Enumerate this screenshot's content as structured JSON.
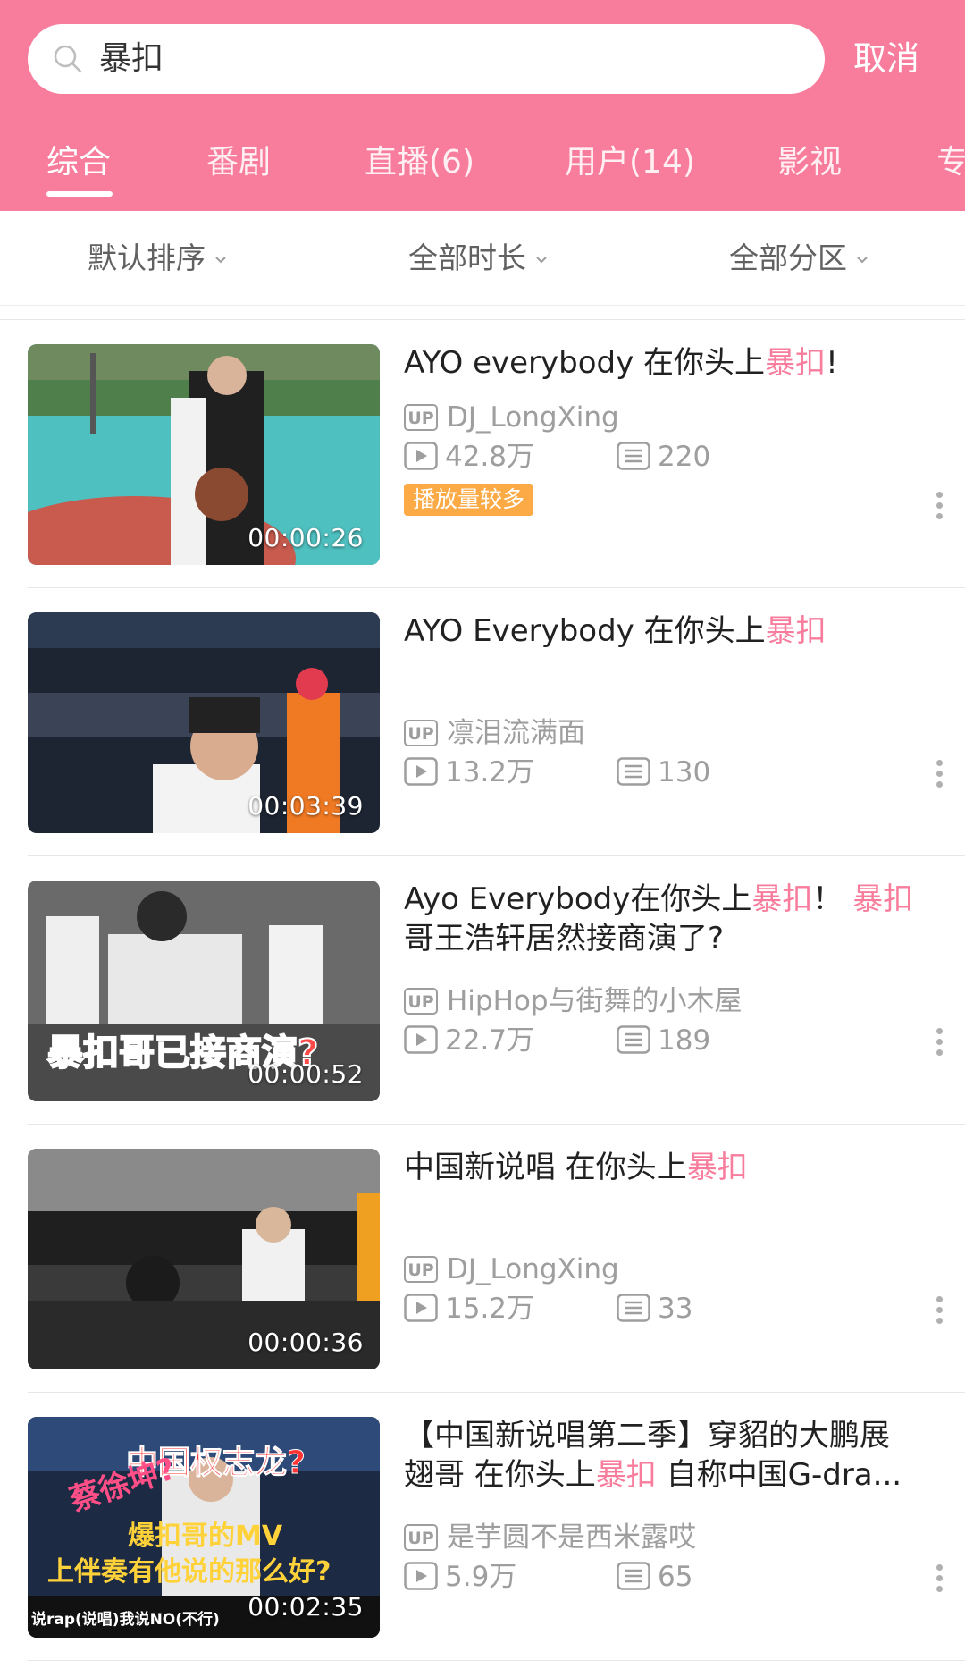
{
  "search": {
    "query": "暴扣",
    "cancel_label": "取消"
  },
  "tabs": [
    {
      "label": "综合",
      "active": true
    },
    {
      "label": "番剧"
    },
    {
      "label": "直播(6)"
    },
    {
      "label": "用户(14)"
    },
    {
      "label": "影视"
    },
    {
      "label": "专"
    }
  ],
  "filters": [
    {
      "label": "默认排序"
    },
    {
      "label": "全部时长"
    },
    {
      "label": "全部分区"
    }
  ],
  "colors": {
    "brand": "#f87d9c",
    "hot_badge": "#fbaa45",
    "meta": "#9e9e9e"
  },
  "items": [
    {
      "title_parts": [
        "AYO everybody 在你头上",
        "暴扣",
        "!"
      ],
      "uploader": "DJ_LongXing",
      "views": "42.8万",
      "comments": "220",
      "duration": "00:00:26",
      "badge": "播放量较多"
    },
    {
      "title_parts": [
        "AYO Everybody 在你头上",
        "暴扣",
        ""
      ],
      "uploader": "凛泪流满面",
      "views": "13.2万",
      "comments": "130",
      "duration": "00:03:39"
    },
    {
      "title_line1_parts": [
        "Ayo Everybody在你头上",
        "暴扣",
        "！ ",
        "暴扣"
      ],
      "title_line2": "哥王浩轩居然接商演了?",
      "uploader": "HipHop与街舞的小木屋",
      "views": "22.7万",
      "comments": "189",
      "duration": "00:00:52",
      "thumb_caption": "暴扣哥已接商演?"
    },
    {
      "title_parts": [
        "中国新说唱 在你头上",
        "暴扣",
        ""
      ],
      "uploader": "DJ_LongXing",
      "views": "15.2万",
      "comments": "33",
      "duration": "00:00:36"
    },
    {
      "title_line1": "【中国新说唱第二季】穿貂的大鹏展",
      "title_line2_parts": [
        "翅哥 在你头上",
        "暴扣",
        " 自称中国G-dra..."
      ],
      "uploader": "是芋圆不是西米露哎",
      "views": "5.9万",
      "comments": "65",
      "duration": "00:02:35",
      "thumb_caption_1": "中国权志龙?",
      "thumb_caption_2": "蔡徐坤?",
      "thumb_caption_3": "爆扣哥的MV",
      "thumb_caption_4": "上伴奏有他说的那么好?",
      "thumb_caption_5": "说rap(说唱)我说NO(不行)"
    }
  ]
}
